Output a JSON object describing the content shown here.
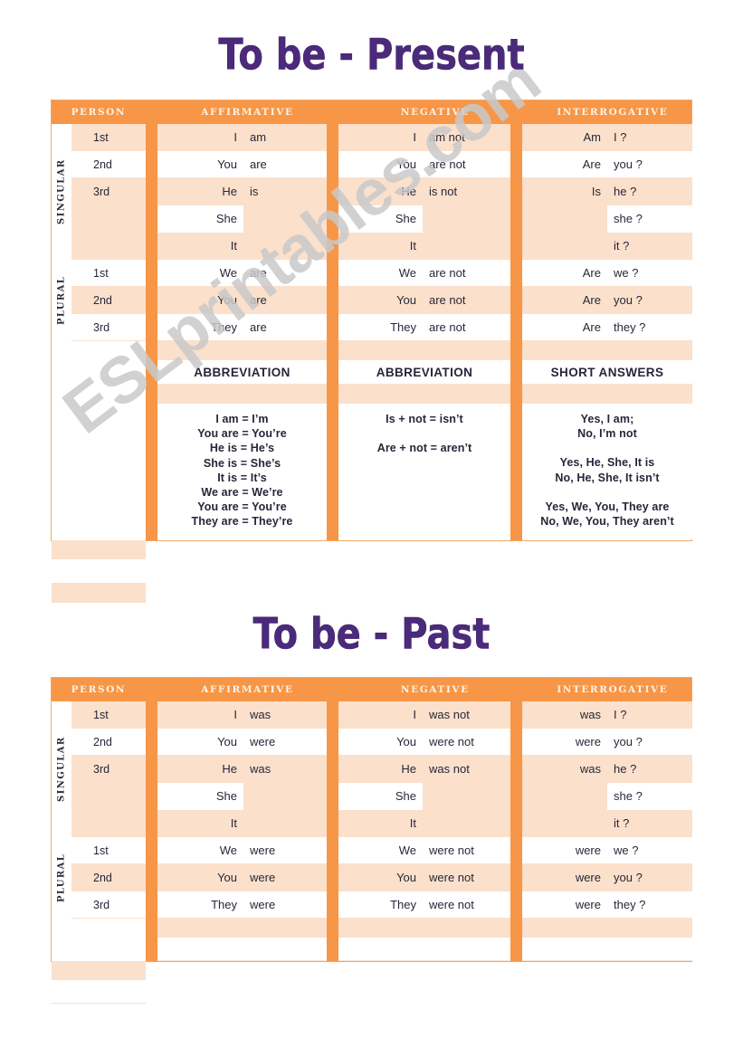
{
  "watermark": {
    "text": "ESLprintables.com"
  },
  "present": {
    "title": "To be - Present",
    "headers": {
      "person": "PERSON",
      "affirmative": "AFFIRMATIVE",
      "negative": "NEGATIVE",
      "interrogative": "INTERROGATIVE"
    },
    "groups": {
      "singular": "SINGULAR",
      "plural": "PLURAL"
    },
    "ordinals": {
      "s1": "1st",
      "s2": "2nd",
      "s3": "3rd",
      "p1": "1st",
      "p2": "2nd",
      "p3": "3rd"
    },
    "rows": [
      {
        "aff_subj": "I",
        "aff_verb": "am",
        "neg_subj": "I",
        "neg_verb": "am not",
        "int_verb": "Am",
        "int_subj": "I ?"
      },
      {
        "aff_subj": "You",
        "aff_verb": "are",
        "neg_subj": "You",
        "neg_verb": "are not",
        "int_verb": "Are",
        "int_subj": "you ?"
      },
      {
        "aff_subj": "He",
        "aff_verb": "is",
        "neg_subj": "He",
        "neg_verb": "is not",
        "int_verb": "Is",
        "int_subj": "he ?"
      },
      {
        "aff_subj": "She",
        "aff_verb": "",
        "neg_subj": "She",
        "neg_verb": "",
        "int_verb": "",
        "int_subj": "she ?"
      },
      {
        "aff_subj": "It",
        "aff_verb": "",
        "neg_subj": "It",
        "neg_verb": "",
        "int_verb": "",
        "int_subj": "it ?"
      },
      {
        "aff_subj": "We",
        "aff_verb": "are",
        "neg_subj": "We",
        "neg_verb": "are not",
        "int_verb": "Are",
        "int_subj": "we ?"
      },
      {
        "aff_subj": "You",
        "aff_verb": "are",
        "neg_subj": "You",
        "neg_verb": "are not",
        "int_verb": "Are",
        "int_subj": "you ?"
      },
      {
        "aff_subj": "They",
        "aff_verb": "are",
        "neg_subj": "They",
        "neg_verb": "are not",
        "int_verb": "Are",
        "int_subj": "they ?"
      }
    ],
    "sections": {
      "aff_label": "ABBREVIATION",
      "neg_label": "ABBREVIATION",
      "int_label": "SHORT ANSWERS"
    },
    "aff_abbrev": [
      "I am = I’m",
      "You are = You’re",
      "He is = He’s",
      "She is = She’s",
      "It is = It’s",
      "We are = We’re",
      "You are = You’re",
      "They are = They’re"
    ],
    "neg_abbrev": {
      "line1": "Is + not = isn’t",
      "line2": "Are + not = aren’t"
    },
    "short_answers": {
      "g1l1": "Yes, I am;",
      "g1l2": "No, I’m not",
      "g2l1": "Yes, He, She, It is",
      "g2l2": "No, He, She, It isn’t",
      "g3l1": "Yes, We, You, They are",
      "g3l2": "No, We, You, They aren’t"
    }
  },
  "past": {
    "title": "To be - Past",
    "headers": {
      "person": "PERSON",
      "affirmative": "AFFIRMATIVE",
      "negative": "NEGATIVE",
      "interrogative": "INTERROGATIVE"
    },
    "groups": {
      "singular": "SINGULAR",
      "plural": "PLURAL"
    },
    "ordinals": {
      "s1": "1st",
      "s2": "2nd",
      "s3": "3rd",
      "p1": "1st",
      "p2": "2nd",
      "p3": "3rd"
    },
    "rows": [
      {
        "aff_subj": "I",
        "aff_verb": "was",
        "neg_subj": "I",
        "neg_verb": "was not",
        "int_verb": "was",
        "int_subj": "I ?"
      },
      {
        "aff_subj": "You",
        "aff_verb": "were",
        "neg_subj": "You",
        "neg_verb": "were not",
        "int_verb": "were",
        "int_subj": "you ?"
      },
      {
        "aff_subj": "He",
        "aff_verb": "was",
        "neg_subj": "He",
        "neg_verb": "was not",
        "int_verb": "was",
        "int_subj": "he ?"
      },
      {
        "aff_subj": "She",
        "aff_verb": "",
        "neg_subj": "She",
        "neg_verb": "",
        "int_verb": "",
        "int_subj": "she ?"
      },
      {
        "aff_subj": "It",
        "aff_verb": "",
        "neg_subj": "It",
        "neg_verb": "",
        "int_verb": "",
        "int_subj": "it ?"
      },
      {
        "aff_subj": "We",
        "aff_verb": "were",
        "neg_subj": "We",
        "neg_verb": "were not",
        "int_verb": "were",
        "int_subj": "we ?"
      },
      {
        "aff_subj": "You",
        "aff_verb": "were",
        "neg_subj": "You",
        "neg_verb": "were not",
        "int_verb": "were",
        "int_subj": "you ?"
      },
      {
        "aff_subj": "They",
        "aff_verb": "were",
        "neg_subj": "They",
        "neg_verb": "were not",
        "int_verb": "were",
        "int_subj": "they ?"
      }
    ]
  },
  "colors": {
    "orange": "#f79646",
    "tint": "#fbe0cb",
    "title_purple": "#4b2a7b",
    "text": "#27273a",
    "watermark_gray": "#c9c9c9"
  }
}
